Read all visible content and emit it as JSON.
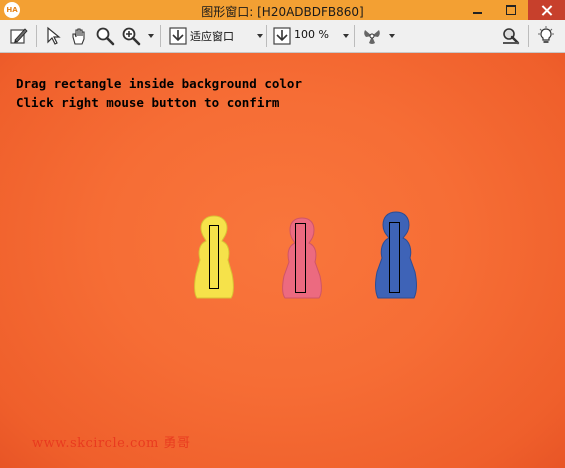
{
  "window": {
    "app_badge": "HA",
    "title": "图形窗口: [H20ADBDFB860]"
  },
  "toolbar": {
    "fit_label": "适应窗口",
    "zoom_label": "100 %"
  },
  "canvas": {
    "instruction_line1": "Drag rectangle inside background color",
    "instruction_line2": "Click right mouse button to confirm",
    "watermark": "www.skcircle.com 勇哥",
    "colors": {
      "background": "#f66d35",
      "figure_yellow": "#f6e24a",
      "figure_pink": "#ec6a80",
      "figure_blue": "#3e63b7"
    }
  },
  "icons": [
    "edit-icon",
    "pointer-icon",
    "pan-hand-icon",
    "magnifier-icon",
    "zoom-in-icon",
    "fit-window-icon",
    "zoom-percent-icon",
    "fan-settings-icon",
    "inspect-icon",
    "lightbulb-icon"
  ]
}
